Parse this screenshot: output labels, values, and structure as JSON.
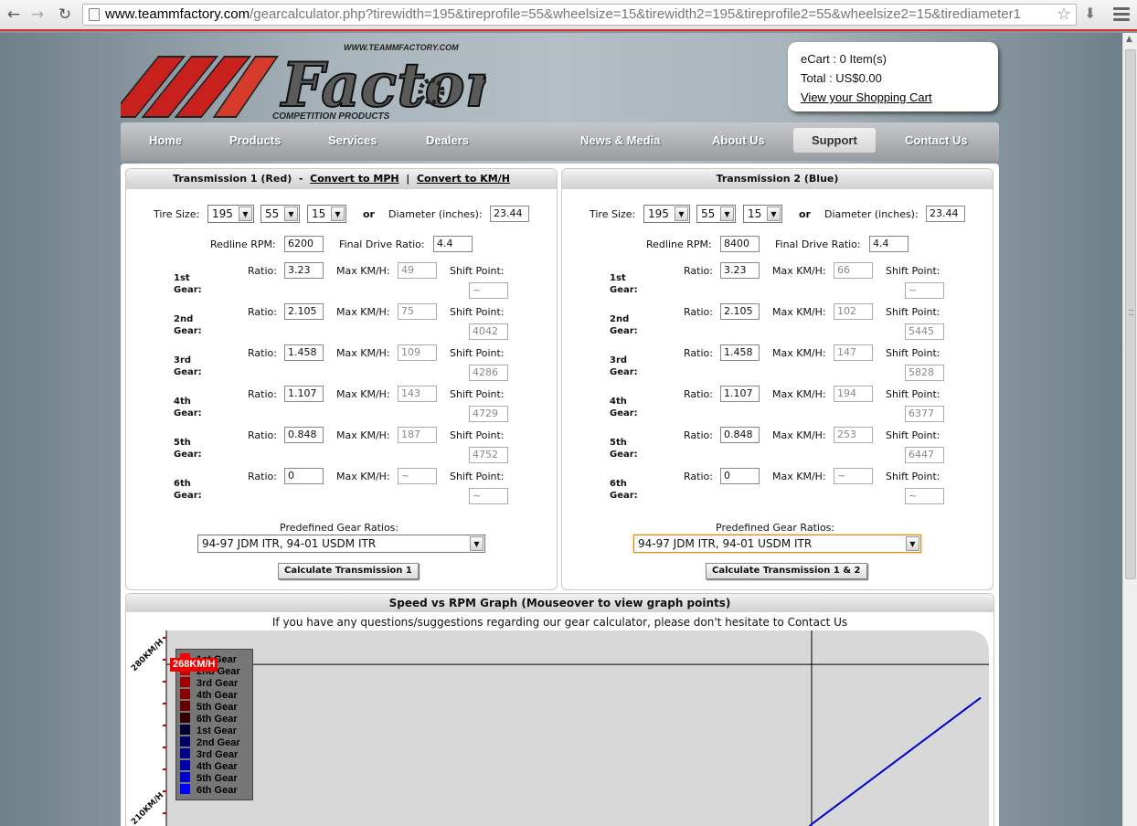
{
  "browser": {
    "url_host": "www.teammfactory.com",
    "url_path": "/gearcalculator.php?tirewidth=195&tireprofile=55&wheelsize=15&tirewidth2=195&tireprofile2=55&wheelsize2=15&tirediameter1"
  },
  "logo": {
    "url_text": "WWW.TEAMMFACTORY.COM",
    "wordmark": "Factory",
    "tagline": "COMPETITION PRODUCTS"
  },
  "ecart": {
    "items": "eCart : 0 Item(s)",
    "total": "Total : US$0.00",
    "view_link": "View your Shopping Cart"
  },
  "nav": {
    "home": "Home",
    "products": "Products",
    "services": "Services",
    "dealers": "Dealers",
    "news": "News & Media",
    "about": "About Us",
    "support": "Support",
    "contact": "Contact Us"
  },
  "labels": {
    "tire_size": "Tire Size:",
    "or": "or",
    "diameter": "Diameter (inches):",
    "redline": "Redline RPM:",
    "final_drive": "Final Drive Ratio:",
    "ratio": "Ratio:",
    "max_kmh": "Max KM/H:",
    "shift_point": "Shift Point:",
    "predefined": "Predefined Gear Ratios:",
    "gear_word": "Gear:"
  },
  "gear_names": [
    "1st",
    "2nd",
    "3rd",
    "4th",
    "5th",
    "6th"
  ],
  "transmission1": {
    "title": "Transmission 1 (Red)",
    "convert_mph": "Convert to MPH",
    "separator": "|",
    "convert_kmh": "Convert to KM/H",
    "tire_width": "195",
    "tire_profile": "55",
    "wheel_size": "15",
    "diameter": "23.44",
    "redline": "6200",
    "final_drive": "4.4",
    "gears": [
      {
        "ratio": "3.23",
        "max": "49",
        "shift": "~"
      },
      {
        "ratio": "2.105",
        "max": "75",
        "shift": "4042"
      },
      {
        "ratio": "1.458",
        "max": "109",
        "shift": "4286"
      },
      {
        "ratio": "1.107",
        "max": "143",
        "shift": "4729"
      },
      {
        "ratio": "0.848",
        "max": "187",
        "shift": "4752"
      },
      {
        "ratio": "0",
        "max": "~",
        "shift": "~"
      }
    ],
    "predefined": "94-97 JDM ITR, 94-01 USDM ITR",
    "button": "Calculate Transmission 1"
  },
  "transmission2": {
    "title": "Transmission 2 (Blue)",
    "tire_width": "195",
    "tire_profile": "55",
    "wheel_size": "15",
    "diameter": "23.44",
    "redline": "8400",
    "final_drive": "4.4",
    "gears": [
      {
        "ratio": "3.23",
        "max": "66",
        "shift": "~"
      },
      {
        "ratio": "2.105",
        "max": "102",
        "shift": "5445"
      },
      {
        "ratio": "1.458",
        "max": "147",
        "shift": "5828"
      },
      {
        "ratio": "1.107",
        "max": "194",
        "shift": "6377"
      },
      {
        "ratio": "0.848",
        "max": "253",
        "shift": "6447"
      },
      {
        "ratio": "0",
        "max": "~",
        "shift": "~"
      }
    ],
    "predefined": "94-97 JDM ITR, 94-01 USDM ITR",
    "button": "Calculate Transmission 1 & 2"
  },
  "graph": {
    "title": "Speed vs RPM Graph (Mouseover to view graph points)",
    "subtitle": "If you have any questions/suggestions regarding our gear calculator, please don't hesitate to Contact Us",
    "tooltip": "268KM/H"
  },
  "chart_data": {
    "type": "line",
    "y_tick_labels": [
      "280KM/H",
      "210KM/H"
    ],
    "legend": [
      {
        "name": "1st Gear",
        "color": "#ff0000"
      },
      {
        "name": "2nd Gear",
        "color": "#cc0000"
      },
      {
        "name": "3rd Gear",
        "color": "#a00000"
      },
      {
        "name": "4th Gear",
        "color": "#880000"
      },
      {
        "name": "5th Gear",
        "color": "#660000"
      },
      {
        "name": "6th Gear",
        "color": "#330000"
      },
      {
        "name": "1st Gear",
        "color": "#000033"
      },
      {
        "name": "2nd Gear",
        "color": "#000066"
      },
      {
        "name": "3rd Gear",
        "color": "#000088"
      },
      {
        "name": "4th Gear",
        "color": "#0000aa"
      },
      {
        "name": "5th Gear",
        "color": "#0000cc"
      },
      {
        "name": "6th Gear",
        "color": "#0000ff"
      }
    ],
    "crosshair_value": 268,
    "series": [
      {
        "name": "5th Gear",
        "color": "#0000cc",
        "points": [
          [
            6447,
            196
          ],
          [
            8400,
            253
          ]
        ]
      }
    ]
  }
}
